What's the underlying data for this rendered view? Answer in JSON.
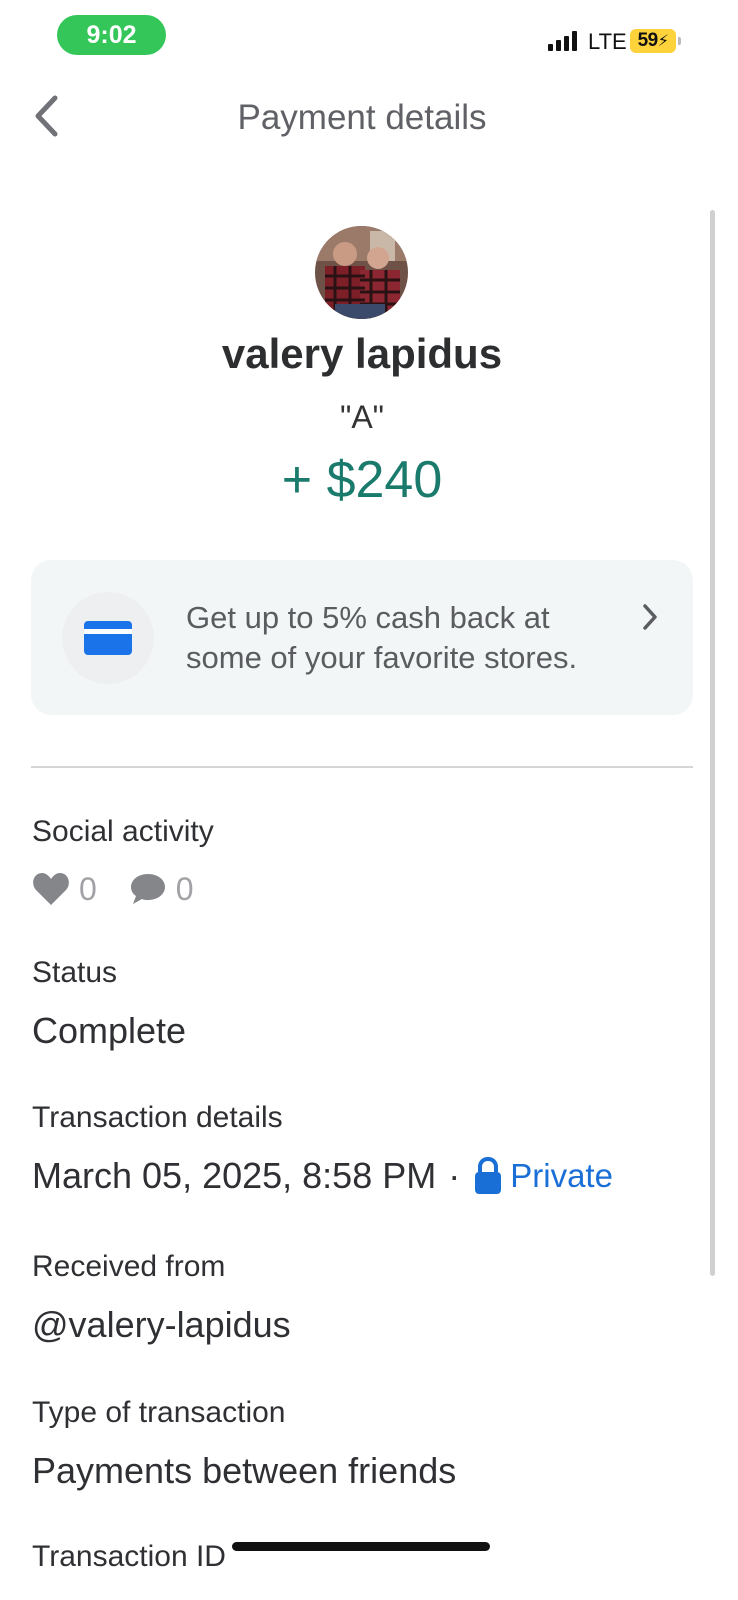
{
  "status_bar": {
    "time": "9:02",
    "network": "LTE",
    "battery": "59"
  },
  "header": {
    "title": "Payment details",
    "back_icon": "chevron-left-icon"
  },
  "profile": {
    "name": "valery lapidus",
    "note": "\"A\"",
    "amount": "+ $240",
    "amount_color": "#1a7a6c"
  },
  "promo": {
    "icon": "credit-card-icon",
    "icon_color": "#1a73e8",
    "text": "Get up to 5% cash back at some of your favorite stores."
  },
  "social": {
    "label": "Social activity",
    "likes": "0",
    "comments": "0"
  },
  "status": {
    "label": "Status",
    "value": "Complete"
  },
  "transaction_details": {
    "label": "Transaction details",
    "date": "March 05, 2025, 8:58 PM",
    "separator": "·",
    "privacy": "Private",
    "privacy_color": "#1a6fd6"
  },
  "received_from": {
    "label": "Received from",
    "value": "@valery-lapidus"
  },
  "type": {
    "label": "Type of transaction",
    "value": "Payments between friends"
  },
  "transaction_id": {
    "label": "Transaction ID"
  }
}
